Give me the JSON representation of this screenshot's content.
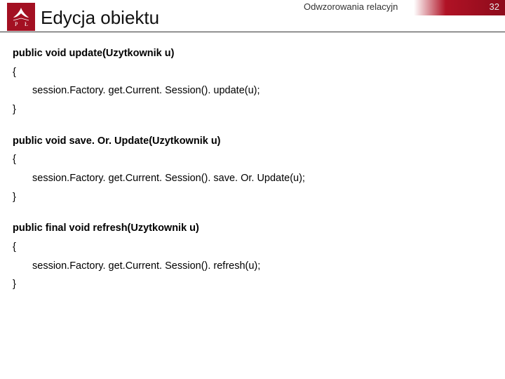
{
  "header": {
    "title": "Edycja obiektu",
    "subtitle": "Odwzorowania relacyjn",
    "page_number": "32"
  },
  "code": {
    "blocks": [
      {
        "signature": "public void update(Uzytkownik u)",
        "open": "{",
        "body": "session.Factory. get.Current. Session(). update(u);",
        "close": "}"
      },
      {
        "signature": "public void save. Or. Update(Uzytkownik u)",
        "open": "{",
        "body": "session.Factory. get.Current. Session(). save. Or. Update(u);",
        "close": "}"
      },
      {
        "signature": "public final void refresh(Uzytkownik u)",
        "open": "{",
        "body": "session.Factory. get.Current. Session(). refresh(u);",
        "close": "}"
      }
    ]
  }
}
